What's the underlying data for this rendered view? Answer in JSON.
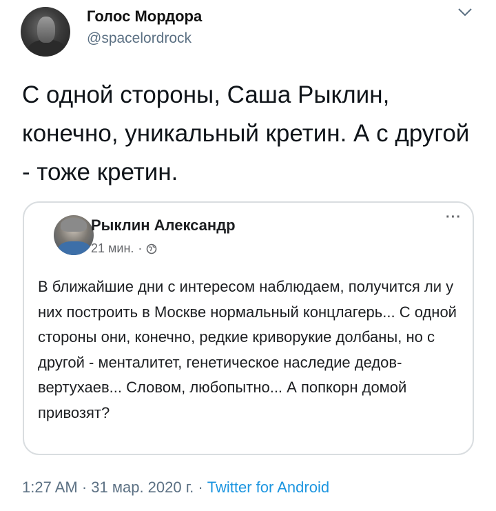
{
  "author": {
    "name": "Голос Мордора",
    "handle": "@spacelordrock"
  },
  "tweet": {
    "text": "С одной стороны, Саша Рыклин, конечно, уникальный кретин. А с другой - тоже кретин."
  },
  "quoted_post": {
    "author_name": "Рыклин Александр",
    "time": "21 мин.",
    "separator": "·",
    "menu_label": "···",
    "text": "В ближайшие дни с интересом наблюдаем, получится ли у них построить в Москве нормальный концлагерь... С одной стороны они, конечно, редкие криворукие долбаны, но с другой - менталитет, генетическое наследие дедов-вертухаев... Словом, любопытно... А попкорн домой привозят?"
  },
  "footer": {
    "time": "1:27 AM",
    "dot1": " · ",
    "date": "31 мар. 2020 г.",
    "dot2": " · ",
    "source": "Twitter for Android"
  },
  "icons": {
    "chevron": "chevron-down-icon",
    "globe": "globe-icon",
    "more": "more-options-icon"
  },
  "colors": {
    "secondary_text": "#5b7083",
    "link": "#1b95e0",
    "card_border": "#d9dde0"
  }
}
